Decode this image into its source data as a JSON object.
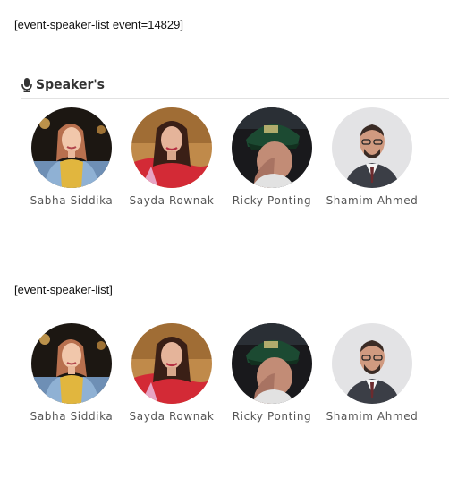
{
  "shortcodes": [
    {
      "text": "[event-speaker-list event=14829]"
    },
    {
      "text": "[event-speaker-list]"
    }
  ],
  "section": {
    "title": "Speaker's",
    "icon": "microphone-icon"
  },
  "speakers": [
    {
      "name": "Sabha Siddika"
    },
    {
      "name": "Sayda Rownak"
    },
    {
      "name": "Ricky Ponting"
    },
    {
      "name": "Shamim Ahmed"
    }
  ],
  "colors": {
    "text": "#111111",
    "title": "#333333",
    "name": "#555555",
    "rule": "#e2e2e2"
  }
}
